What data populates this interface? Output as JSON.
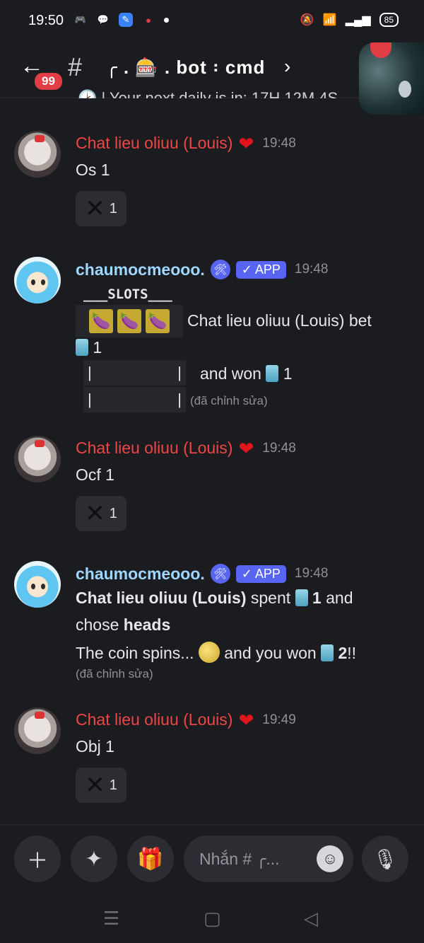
{
  "status": {
    "time": "19:50",
    "battery": "85"
  },
  "header": {
    "back_badge": "99",
    "hash": "#",
    "channel": "╭ . 🎰 . bot ꞉ cmd",
    "chevron": "›"
  },
  "cutoff_text": "🕑 | Your next daily is in: 17H 12M 4S",
  "messages": [
    {
      "user": "Chat lieu oliuu (Louis)",
      "time": "19:48",
      "text": "Os 1",
      "reaction_count": "1"
    },
    {
      "user": "chaumocmeooo.",
      "app": "✓ APP",
      "time": "19:48",
      "slots_title": "___SLOTS___",
      "bet_text": "Chat lieu oliuu (Louis) bet",
      "bet_amount": "1",
      "won_text": "and won",
      "won_amount": "1",
      "pipe": "|",
      "edited": "(đã chỉnh sửa)"
    },
    {
      "user": "Chat lieu oliuu (Louis)",
      "time": "19:48",
      "text": "Ocf 1",
      "reaction_count": "1"
    },
    {
      "user": "chaumocmeooo.",
      "app": "✓ APP",
      "time": "19:48",
      "line1_name": "Chat lieu oliuu (Louis)",
      "line1_mid": "spent",
      "line1_amount": "1",
      "line1_end": "and",
      "line2_pre": "chose",
      "line2_bold": "heads",
      "line3_pre": "The coin spins...",
      "line3_mid": "and you won",
      "line3_amount": "2",
      "line3_end": "!!",
      "edited": "(đã chỉnh sửa)"
    },
    {
      "user": "Chat lieu oliuu (Louis)",
      "time": "19:49",
      "text": "Obj 1",
      "reaction_count": "1"
    }
  ],
  "composer": {
    "placeholder": "Nhắn # ╭..."
  },
  "colors": {
    "background": "#1b1c20",
    "red_name": "#ef4545",
    "blue_name": "#9fd7ff",
    "app_badge": "#5865f2"
  }
}
